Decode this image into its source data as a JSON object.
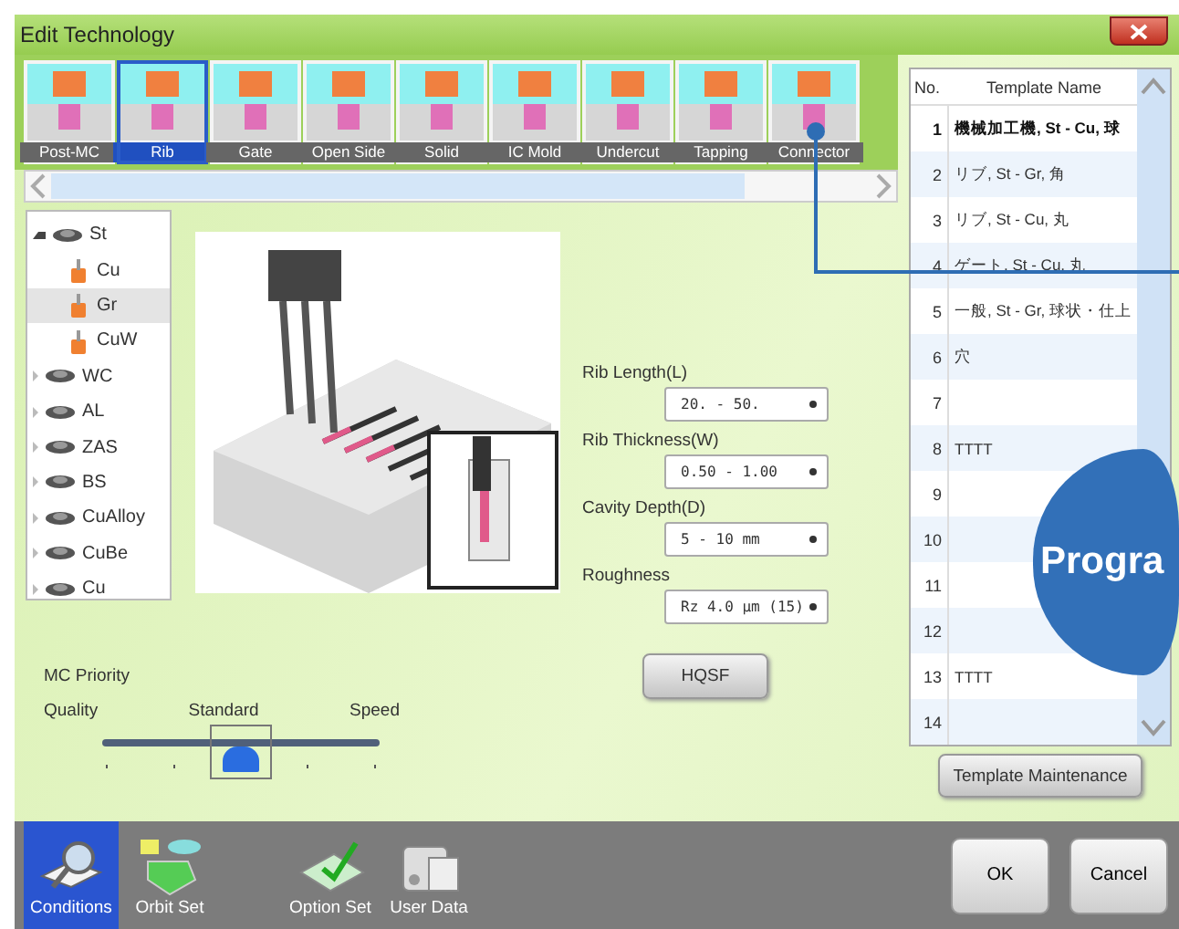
{
  "window": {
    "title": "Edit Technology"
  },
  "shape_tabs": [
    {
      "label": "Post-MC",
      "selected": false
    },
    {
      "label": "Rib",
      "selected": true
    },
    {
      "label": "Gate",
      "selected": false
    },
    {
      "label": "Open Side",
      "selected": false
    },
    {
      "label": "Solid",
      "selected": false
    },
    {
      "label": "IC Mold",
      "selected": false
    },
    {
      "label": "Undercut",
      "selected": false
    },
    {
      "label": "Tapping",
      "selected": false
    },
    {
      "label": "Connector",
      "selected": false
    }
  ],
  "material_tree": [
    {
      "label": "St",
      "expanded": true,
      "selected": false,
      "children": [
        {
          "label": "Cu",
          "selected": false
        },
        {
          "label": "Gr",
          "selected": true
        },
        {
          "label": "CuW",
          "selected": false
        }
      ]
    },
    {
      "label": "WC",
      "expanded": false,
      "selected": false
    },
    {
      "label": "AL",
      "expanded": false,
      "selected": false
    },
    {
      "label": "ZAS",
      "expanded": false,
      "selected": false
    },
    {
      "label": "BS",
      "expanded": false,
      "selected": false
    },
    {
      "label": "CuAlloy",
      "expanded": false,
      "selected": false
    },
    {
      "label": "CuBe",
      "expanded": false,
      "selected": false
    },
    {
      "label": "Cu",
      "expanded": false,
      "selected": false
    }
  ],
  "fields": [
    {
      "label": "Rib Length(L)",
      "value": "20. - 50."
    },
    {
      "label": "Rib Thickness(W)",
      "value": "0.50 - 1.00"
    },
    {
      "label": "Cavity Depth(D)",
      "value": "5 - 10 mm"
    },
    {
      "label": "Roughness",
      "value": "Rz 4.0 µm (15)"
    }
  ],
  "hqsf_button": "HQSF",
  "mc_priority": {
    "title": "MC Priority",
    "labels": [
      "Quality",
      "Standard",
      "Speed"
    ],
    "level": 0.5
  },
  "template_list": {
    "columns": [
      "No.",
      "Template Name"
    ],
    "rows": [
      {
        "no": "1",
        "name": "機械加工機, St - Cu, 球",
        "selected": true
      },
      {
        "no": "2",
        "name": "リブ, St - Gr, 角",
        "selected": false
      },
      {
        "no": "3",
        "name": "リブ, St - Cu, 丸",
        "selected": false
      },
      {
        "no": "4",
        "name": "ゲート, St - Cu, 丸",
        "selected": false
      },
      {
        "no": "5",
        "name": "一般, St - Gr, 球状・仕上",
        "selected": false
      },
      {
        "no": "6",
        "name": "穴",
        "selected": false
      },
      {
        "no": "7",
        "name": "",
        "selected": false
      },
      {
        "no": "8",
        "name": "TTTT",
        "selected": false
      },
      {
        "no": "9",
        "name": "",
        "selected": false
      },
      {
        "no": "10",
        "name": "",
        "selected": false
      },
      {
        "no": "11",
        "name": "",
        "selected": false
      },
      {
        "no": "12",
        "name": "",
        "selected": false
      },
      {
        "no": "13",
        "name": "TTTT",
        "selected": false
      },
      {
        "no": "14",
        "name": "",
        "selected": false
      }
    ]
  },
  "template_maintenance_button": "Template Maintenance",
  "toolbar": [
    {
      "label": "Conditions",
      "kind": "book",
      "selected": true
    },
    {
      "label": "Orbit Set",
      "kind": "blocks",
      "selected": false
    },
    {
      "label": "Option Set",
      "kind": "tray",
      "selected": false
    },
    {
      "label": "User Data",
      "kind": "drive",
      "selected": false
    }
  ],
  "buttons": [
    "OK",
    "Cancel"
  ],
  "callout": {
    "text": "Progra"
  }
}
